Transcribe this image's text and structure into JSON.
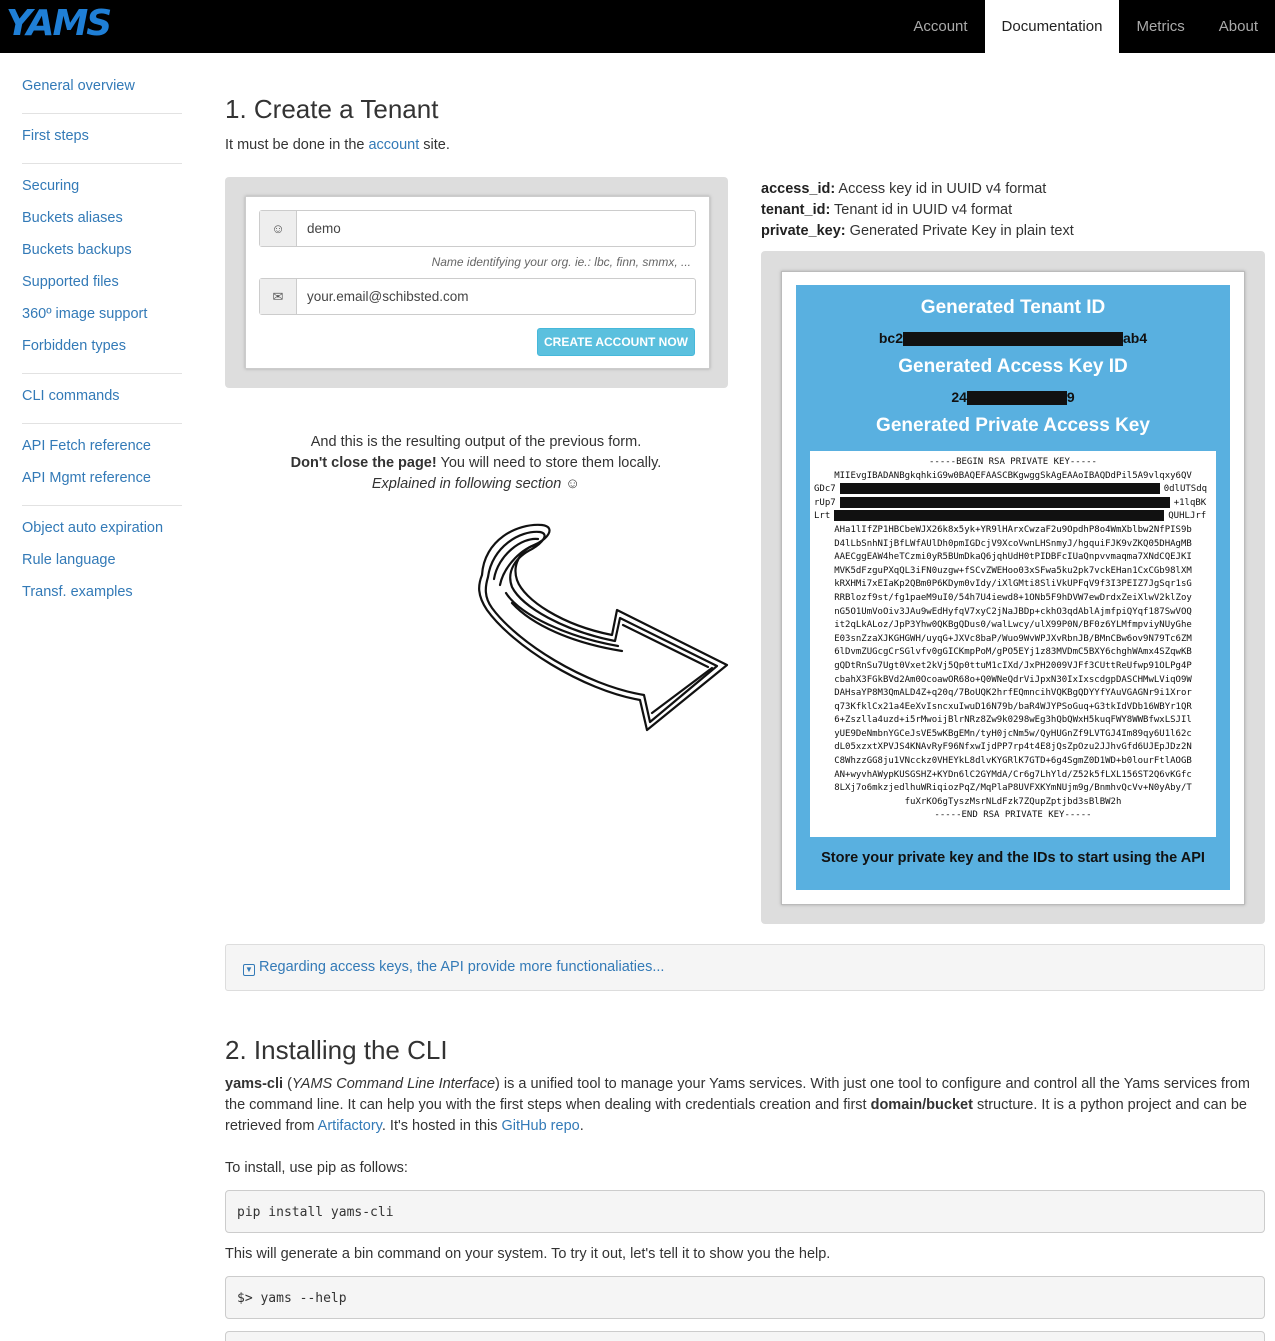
{
  "brand": {
    "logo_text": "YAMS",
    "accent": "#1f7fd6"
  },
  "nav": {
    "items": [
      {
        "label": "Account"
      },
      {
        "label": "Documentation"
      },
      {
        "label": "Metrics"
      },
      {
        "label": "About"
      }
    ],
    "active": "Documentation"
  },
  "sidebar": {
    "groups": [
      [
        "General overview"
      ],
      [
        "First steps"
      ],
      [
        "Securing",
        "Buckets aliases",
        "Buckets backups",
        "Supported files",
        "360º image support",
        "Forbidden types"
      ],
      [
        "CLI commands"
      ],
      [
        "API Fetch reference",
        "API Mgmt reference"
      ],
      [
        "Object auto expiration",
        "Rule language",
        "Transf. examples"
      ]
    ]
  },
  "section1": {
    "title": "1. Create a Tenant",
    "intro_before": "It must be done in the ",
    "intro_link": "account",
    "intro_after": " site.",
    "form": {
      "name_value": "demo",
      "name_icon": "user-icon",
      "hint": "Name identifying your org. ie.: lbc, finn, smmx, ...",
      "email_value": "your.email@schibsted.com",
      "email_icon": "envelope-icon",
      "button": "CREATE ACCOUNT NOW"
    },
    "output_line1": "And this is the resulting output of the previous form.",
    "output_bold": "Don't close the page!",
    "output_line2_rest": " You will need to store them locally.",
    "output_italic": "Explained in following section ☺",
    "fields": [
      {
        "key": "access_id:",
        "desc": " Access key id in UUID v4 format"
      },
      {
        "key": "tenant_id:",
        "desc": " Tenant id in UUID v4 format"
      },
      {
        "key": "private_key:",
        "desc": " Generated Private Key in plain text"
      }
    ],
    "generated": {
      "tenant_title": "Generated Tenant ID",
      "tenant_prefix": "bc2",
      "tenant_suffix": "ab4",
      "access_title": "Generated Access Key ID",
      "access_prefix": "24",
      "access_suffix": "9",
      "private_title": "Generated Private Access Key",
      "key_lines": [
        "-----BEGIN RSA PRIVATE KEY-----",
        "MIIEvgIBADANBgkqhkiG9w0BAQEFAASCBKgwggSkAgEAAoIBAQDdPil5A9vlqxy6QV",
        "GDc7",
        "rUp7",
        "Lrt",
        "AHa1lIfZP1HBCbeWJX26k8x5yk+YR9lHArxCwzaF2u9OpdhP8o4WmXblbw2NfPIS9b",
        "D4lLbSnhNIjBfLWfAUlDh0pmIGDcjV9XcoVwnLHSnmyJ/hgquiFJK9vZKQ05DHAgMB",
        "AAECggEAW4heTCzmi0yR5BUmDkaQ6jqhUdH0tPIDBFcIUaQnpvvmaqma7XNdCQEJKI",
        "MVK5dFzguPXqQL3iFN0uzgw+fSCvZWEHoo03xSFwa5ku2pk7vckEHan1CxCGb98lXM",
        "kRXHMi7xEIaKp2QBm0P6KDym0vIdy/iXlGMti8SliVkUPFqV9f3I3PEIZ7JgSqr1sG",
        "RRBlozf9st/fg1paeM9uI0/54h7U4iewd8+1ONb5F9hDVW7ewDrdxZeiXlwV2klZoy",
        "nG5O1UmVoOiv3JAu9wEdHyfqV7xyC2jNaJBDp+ckhO3qdAblAjmfpiQYqf187SwVOQ",
        "it2qLkALoz/JpP3Yhw0QKBgQDus0/walLwcy/ulX99P0N/BF0z6YLMfmpviyNUyGhe",
        "E03snZzaXJKGHGWH/uyqG+JXVc8baP/Wuo9WvWPJXvRbnJB/BMnCBw6ov9N79Tc6ZM",
        "6lDvmZUGcgCrSGlvfv0gGICKmpPoM/gPO5EYj1z83MVDmC5BXY6chghWAmx4SZqwKB",
        "gQDtRnSu7Ugt0Vxet2kVj5Qp0ttuM1cIXd/JxPH2009VJFf3CUttReUfwp91OLPg4P",
        "cbahX3FGkBVd2Am0OcoawOR68o+Q0WNeQdrViJpxN30IxIxscdgpDASCHMwLViqO9W",
        "DAHsaYP8M3QmALD4Z+q20q/7BoUQK2hrfEQmncihVQKBgQDYYfYAuVGAGNr9i1Xror",
        "q73KfklCx21a4EeXvIsncxuIwuD16N79b/baR4WJYPSoGuq+G3tkIdVDb16WBYr1QR",
        "6+Zszlla4uzd+i5rMwoijBlrNRz8Zw9k0298wEg3hQbQWxH5kuqFWY8WWBfwxLSJIl",
        "yUE9DeNmbnYGCeJsVE5wKBgEMn/tyH0jcNm5w/QyHUGnZf9LVTGJ4Im89qy6U1l62c",
        "dL05xzxtXPVJS4KNAvRyF96NfxwIjdPP7rp4t4E8jQsZpOzu2JJhvGfd6UJEpJDz2N",
        "C8WhzzGG8ju1VNcckz0VHEYkL8dlvKYGRlK7GTD+6g4SgmZ0D1WD+b0lourFtlAOGB",
        "AN+wyvhAWypKUSGSHZ+KYDn6lC2GYMdA/Cr6g7LhYld/Z52k5fLXL156ST2Q6vKGfc",
        "8LXj7o6mkzjedlhuWRiqiozPqZ/MqPlaP8UVFXKYmNUjm9g/BnmhvQcVv+N0yAby/T",
        "fuXrKO6gTyszMsrNLdFzk7ZQupZptjbd3sBlBW2h",
        "-----END RSA PRIVATE KEY-----"
      ],
      "redacted_line_ends": [
        "0dlUTSdq",
        "+1lqBK",
        "QUHLJrf"
      ],
      "footer": "Store your private key and the IDs to start using the API"
    },
    "collapse_label": "Regarding access keys, the API provide more functionaliaties..."
  },
  "section2": {
    "title": "2. Installing the CLI",
    "p_bold1": "yams-cli",
    "p_italic": "YAMS Command Line Interface",
    "p_text1": " is a unified tool to manage your Yams services. With just one tool to configure and control all the Yams services from the command line. It can help you with the first steps when dealing with credentials creation and first ",
    "p_bold2": "domain/bucket",
    "p_text2": " structure. It is a python project and can be retrieved from ",
    "p_link1": "Artifactory",
    "p_text3": ". It's hosted in this ",
    "p_link2": "GitHub repo",
    "p_text4": ".",
    "install_text": "To install, use pip as follows:",
    "code1": "pip install yams-cli",
    "generate_text": "This will generate a bin command on your system. To try it out, let's tell it to show you the help.",
    "code2": "$> yams --help"
  }
}
